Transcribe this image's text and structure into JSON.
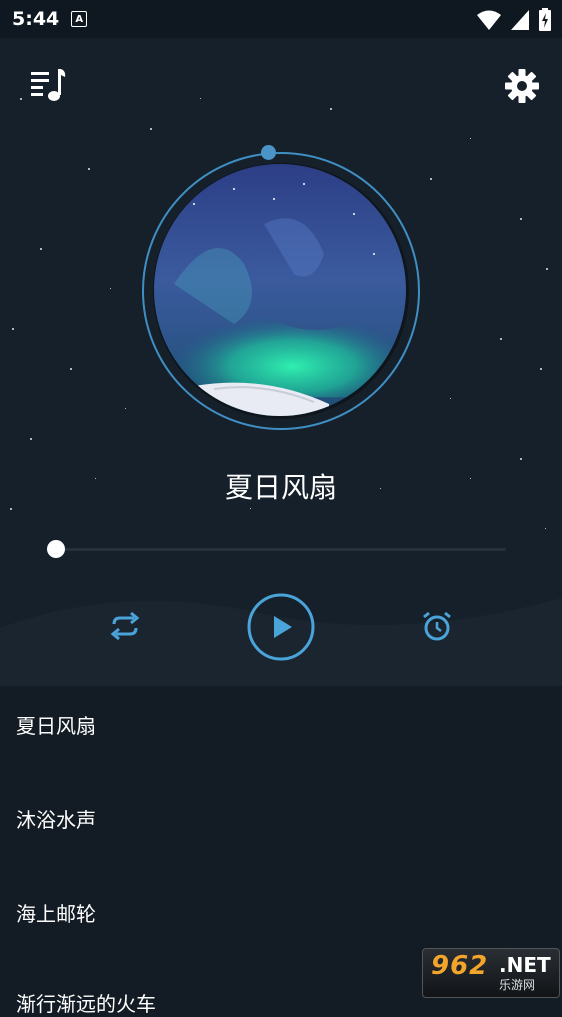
{
  "status_bar": {
    "time": "5:44",
    "notification_icon": "A",
    "icons": [
      "wifi-icon",
      "signal-icon",
      "battery-charging-icon"
    ]
  },
  "header": {
    "playlist_icon": "playlist-music-icon",
    "settings_icon": "gear-icon"
  },
  "now_playing": {
    "title": "夏日风扇",
    "progress": 0.0
  },
  "controls": {
    "repeat_icon": "repeat-icon",
    "play_icon": "play-icon",
    "timer_icon": "alarm-clock-icon"
  },
  "playlist": {
    "items": [
      {
        "label": "夏日风扇"
      },
      {
        "label": "沐浴水声"
      },
      {
        "label": "海上邮轮"
      },
      {
        "label": "渐行渐远的火车"
      }
    ]
  },
  "watermark": {
    "number": "962",
    "net": ".NET",
    "sub": "乐游网"
  },
  "colors": {
    "accent": "#4a9fd6",
    "background": "#131c24",
    "player_background": "#16202a"
  }
}
